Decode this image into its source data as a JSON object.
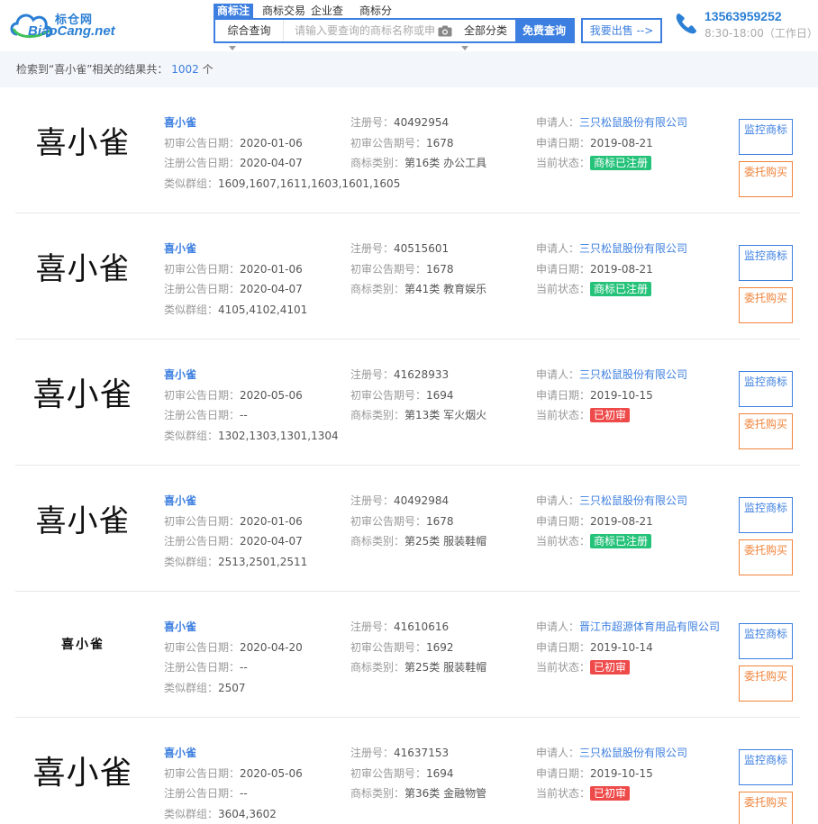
{
  "logo": {
    "cn": "标仓网",
    "en": "BiaoCang.net"
  },
  "search_tabs": [
    "商标注",
    "商标交易",
    "企业查",
    "商标分"
  ],
  "search": {
    "type": "综合查询",
    "placeholder": "请输入要查询的商标名称或申请号",
    "category": "全部分类",
    "submit": "免费查询"
  },
  "sell_button": "我要出售 -->",
  "contact": {
    "phone": "13563959252",
    "hours": "8:30-18:00（工作日）"
  },
  "results": {
    "prefix": "检索到“喜小雀”相关的结果共：",
    "count": "1002",
    "suffix": "个"
  },
  "labels": {
    "first_trial_date": "初审公告日期：",
    "reg_date": "注册公告日期：",
    "similar_group": "类似群组：",
    "reg_no": "注册号：",
    "first_trial_issue": "初审公告期号：",
    "category": "商标类别：",
    "applicant": "申请人：",
    "apply_date": "申请日期：",
    "status": "当前状态：",
    "monitor_btn": "监控商标",
    "entrust_btn": "委托购买"
  },
  "items": [
    {
      "mark": "喜小雀",
      "name": "喜小雀",
      "first_trial_date": "2020-01-06",
      "reg_date": "2020-04-07",
      "similar_group": "1609,1607,1611,1603,1601,1605",
      "reg_no": "40492954",
      "first_trial_issue": "1678",
      "category": "第16类 办公工具",
      "applicant": "三只松鼠股份有限公司",
      "apply_date": "2019-08-21",
      "status": "商标已注册",
      "status_color": "#25c27a"
    },
    {
      "mark": "喜小雀",
      "name": "喜小雀",
      "first_trial_date": "2020-01-06",
      "reg_date": "2020-04-07",
      "similar_group": "4105,4102,4101",
      "reg_no": "40515601",
      "first_trial_issue": "1678",
      "category": "第41类 教育娱乐",
      "applicant": "三只松鼠股份有限公司",
      "apply_date": "2019-08-21",
      "status": "商标已注册",
      "status_color": "#25c27a"
    },
    {
      "mark": "喜小雀",
      "name": "喜小雀",
      "first_trial_date": "2020-05-06",
      "reg_date": "--",
      "similar_group": "1302,1303,1301,1304",
      "reg_no": "41628933",
      "first_trial_issue": "1694",
      "category": "第13类 军火烟火",
      "applicant": "三只松鼠股份有限公司",
      "apply_date": "2019-10-15",
      "status": "已初审",
      "status_color": "#ef4a4a"
    },
    {
      "mark": "喜小雀",
      "name": "喜小雀",
      "first_trial_date": "2020-01-06",
      "reg_date": "2020-04-07",
      "similar_group": "2513,2501,2511",
      "reg_no": "40492984",
      "first_trial_issue": "1678",
      "category": "第25类 服装鞋帽",
      "applicant": "三只松鼠股份有限公司",
      "apply_date": "2019-08-21",
      "status": "商标已注册",
      "status_color": "#25c27a"
    },
    {
      "mark": "喜小雀",
      "name": "喜小雀",
      "first_trial_date": "2020-04-20",
      "reg_date": "--",
      "similar_group": "2507",
      "reg_no": "41610616",
      "first_trial_issue": "1692",
      "category": "第25类 服装鞋帽",
      "applicant": "晋江市超源体育用品有限公司",
      "apply_date": "2019-10-14",
      "status": "已初审",
      "status_color": "#ef4a4a"
    },
    {
      "mark": "喜小雀",
      "name": "喜小雀",
      "first_trial_date": "2020-05-06",
      "reg_date": "--",
      "similar_group": "3604,3602",
      "reg_no": "41637153",
      "first_trial_issue": "1694",
      "category": "第36类 金融物管",
      "applicant": "三只松鼠股份有限公司",
      "apply_date": "2019-10-15",
      "status": "已初审",
      "status_color": "#ef4a4a"
    }
  ],
  "icons": {
    "logo": "cloud-logo-icon",
    "camera": "camera-icon",
    "phone": "phone-icon"
  }
}
